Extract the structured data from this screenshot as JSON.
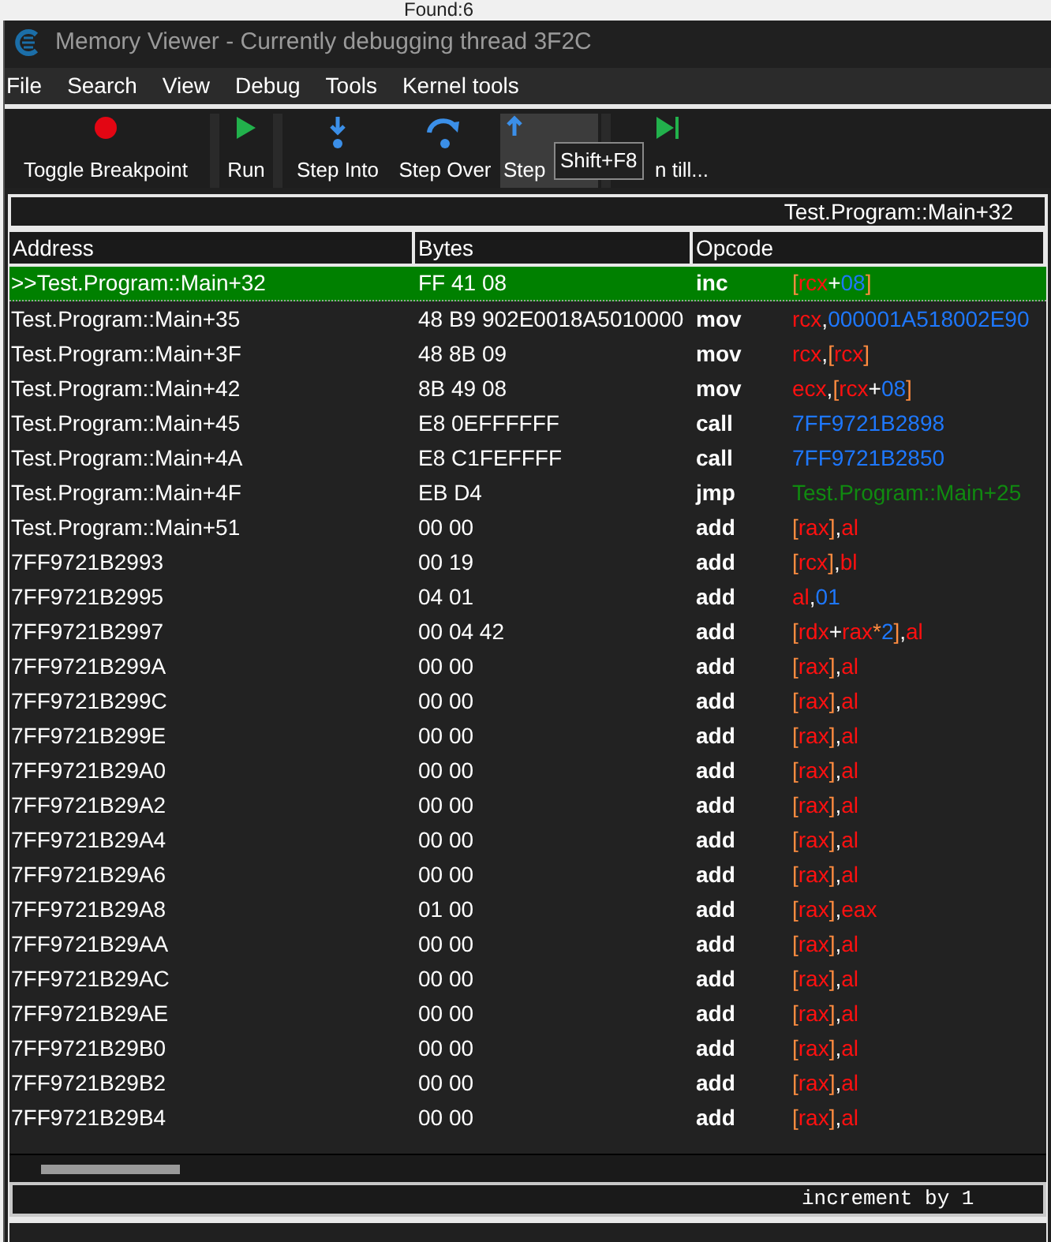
{
  "background_text": "Found:6",
  "window": {
    "title": "Memory Viewer - Currently debugging thread 3F2C"
  },
  "menu": [
    "File",
    "Search",
    "View",
    "Debug",
    "Tools",
    "Kernel tools"
  ],
  "toolbar": [
    {
      "label": "Toggle Breakpoint",
      "kind": "breakpoint",
      "hovered": false
    },
    {
      "label": "Run",
      "kind": "run",
      "hovered": false
    },
    {
      "label": "Step Into",
      "kind": "step_into",
      "hovered": false
    },
    {
      "label": "Step Over",
      "kind": "step_over",
      "hovered": false
    },
    {
      "label": "Step",
      "kind": "step_out",
      "hovered": true
    },
    {
      "label": "n till...",
      "kind": "run_till",
      "hovered": false
    }
  ],
  "tooltip": "Shift+F8",
  "address_bar": "Test.Program::Main+32",
  "table": {
    "columns": [
      "Address",
      "Bytes",
      "Opcode"
    ],
    "rows": [
      {
        "address": ">>Test.Program::Main+32",
        "bytes": "FF 41 08",
        "opcode": "inc",
        "selected": true,
        "operands": [
          {
            "text": "[",
            "kind": "bracket"
          },
          {
            "text": "rcx",
            "kind": "register"
          },
          {
            "text": "+",
            "kind": "separator"
          },
          {
            "text": "08",
            "kind": "number"
          },
          {
            "text": "]",
            "kind": "bracket"
          }
        ]
      },
      {
        "address": "Test.Program::Main+35",
        "bytes": "48 B9 902E0018A5010000",
        "opcode": "mov",
        "selected": false,
        "operands": [
          {
            "text": "rcx",
            "kind": "register"
          },
          {
            "text": ",",
            "kind": "separator"
          },
          {
            "text": "000001A518002E90",
            "kind": "number"
          }
        ]
      },
      {
        "address": "Test.Program::Main+3F",
        "bytes": "48 8B 09",
        "opcode": "mov",
        "selected": false,
        "operands": [
          {
            "text": "rcx",
            "kind": "register"
          },
          {
            "text": ",",
            "kind": "separator"
          },
          {
            "text": "[",
            "kind": "bracket"
          },
          {
            "text": "rcx",
            "kind": "register"
          },
          {
            "text": "]",
            "kind": "bracket"
          }
        ]
      },
      {
        "address": "Test.Program::Main+42",
        "bytes": "8B 49 08",
        "opcode": "mov",
        "selected": false,
        "operands": [
          {
            "text": "ecx",
            "kind": "register"
          },
          {
            "text": ",",
            "kind": "separator"
          },
          {
            "text": "[",
            "kind": "bracket"
          },
          {
            "text": "rcx",
            "kind": "register"
          },
          {
            "text": "+",
            "kind": "separator"
          },
          {
            "text": "08",
            "kind": "number"
          },
          {
            "text": "]",
            "kind": "bracket"
          }
        ]
      },
      {
        "address": "Test.Program::Main+45",
        "bytes": "E8 0EFFFFFF",
        "opcode": "call",
        "selected": false,
        "operands": [
          {
            "text": "7FF9721B2898",
            "kind": "number"
          }
        ]
      },
      {
        "address": "Test.Program::Main+4A",
        "bytes": "E8 C1FEFFFF",
        "opcode": "call",
        "selected": false,
        "operands": [
          {
            "text": "7FF9721B2850",
            "kind": "number"
          }
        ]
      },
      {
        "address": "Test.Program::Main+4F",
        "bytes": "EB D4",
        "opcode": "jmp",
        "selected": false,
        "operands": [
          {
            "text": "Test.Program::Main+25",
            "kind": "symbol"
          }
        ]
      },
      {
        "address": "Test.Program::Main+51",
        "bytes": "00 00",
        "opcode": "add",
        "selected": false,
        "operands": [
          {
            "text": "[",
            "kind": "bracket"
          },
          {
            "text": "rax",
            "kind": "register"
          },
          {
            "text": "]",
            "kind": "bracket"
          },
          {
            "text": ",",
            "kind": "separator"
          },
          {
            "text": "al",
            "kind": "register"
          }
        ]
      },
      {
        "address": "7FF9721B2993",
        "bytes": "00 19",
        "opcode": "add",
        "selected": false,
        "operands": [
          {
            "text": "[",
            "kind": "bracket"
          },
          {
            "text": "rcx",
            "kind": "register"
          },
          {
            "text": "]",
            "kind": "bracket"
          },
          {
            "text": ",",
            "kind": "separator"
          },
          {
            "text": "bl",
            "kind": "register"
          }
        ]
      },
      {
        "address": "7FF9721B2995",
        "bytes": "04 01",
        "opcode": "add",
        "selected": false,
        "operands": [
          {
            "text": "al",
            "kind": "register"
          },
          {
            "text": ",",
            "kind": "separator"
          },
          {
            "text": "01",
            "kind": "number"
          }
        ]
      },
      {
        "address": "7FF9721B2997",
        "bytes": "00 04 42",
        "opcode": "add",
        "selected": false,
        "operands": [
          {
            "text": "[",
            "kind": "bracket"
          },
          {
            "text": "rdx",
            "kind": "register"
          },
          {
            "text": "+",
            "kind": "separator"
          },
          {
            "text": "rax",
            "kind": "register"
          },
          {
            "text": "*",
            "kind": "bracket"
          },
          {
            "text": "2",
            "kind": "number"
          },
          {
            "text": "]",
            "kind": "bracket"
          },
          {
            "text": ",",
            "kind": "separator"
          },
          {
            "text": "al",
            "kind": "register"
          }
        ]
      },
      {
        "address": "7FF9721B299A",
        "bytes": "00 00",
        "opcode": "add",
        "selected": false,
        "operands": [
          {
            "text": "[",
            "kind": "bracket"
          },
          {
            "text": "rax",
            "kind": "register"
          },
          {
            "text": "]",
            "kind": "bracket"
          },
          {
            "text": ",",
            "kind": "separator"
          },
          {
            "text": "al",
            "kind": "register"
          }
        ]
      },
      {
        "address": "7FF9721B299C",
        "bytes": "00 00",
        "opcode": "add",
        "selected": false,
        "operands": [
          {
            "text": "[",
            "kind": "bracket"
          },
          {
            "text": "rax",
            "kind": "register"
          },
          {
            "text": "]",
            "kind": "bracket"
          },
          {
            "text": ",",
            "kind": "separator"
          },
          {
            "text": "al",
            "kind": "register"
          }
        ]
      },
      {
        "address": "7FF9721B299E",
        "bytes": "00 00",
        "opcode": "add",
        "selected": false,
        "operands": [
          {
            "text": "[",
            "kind": "bracket"
          },
          {
            "text": "rax",
            "kind": "register"
          },
          {
            "text": "]",
            "kind": "bracket"
          },
          {
            "text": ",",
            "kind": "separator"
          },
          {
            "text": "al",
            "kind": "register"
          }
        ]
      },
      {
        "address": "7FF9721B29A0",
        "bytes": "00 00",
        "opcode": "add",
        "selected": false,
        "operands": [
          {
            "text": "[",
            "kind": "bracket"
          },
          {
            "text": "rax",
            "kind": "register"
          },
          {
            "text": "]",
            "kind": "bracket"
          },
          {
            "text": ",",
            "kind": "separator"
          },
          {
            "text": "al",
            "kind": "register"
          }
        ]
      },
      {
        "address": "7FF9721B29A2",
        "bytes": "00 00",
        "opcode": "add",
        "selected": false,
        "operands": [
          {
            "text": "[",
            "kind": "bracket"
          },
          {
            "text": "rax",
            "kind": "register"
          },
          {
            "text": "]",
            "kind": "bracket"
          },
          {
            "text": ",",
            "kind": "separator"
          },
          {
            "text": "al",
            "kind": "register"
          }
        ]
      },
      {
        "address": "7FF9721B29A4",
        "bytes": "00 00",
        "opcode": "add",
        "selected": false,
        "operands": [
          {
            "text": "[",
            "kind": "bracket"
          },
          {
            "text": "rax",
            "kind": "register"
          },
          {
            "text": "]",
            "kind": "bracket"
          },
          {
            "text": ",",
            "kind": "separator"
          },
          {
            "text": "al",
            "kind": "register"
          }
        ]
      },
      {
        "address": "7FF9721B29A6",
        "bytes": "00 00",
        "opcode": "add",
        "selected": false,
        "operands": [
          {
            "text": "[",
            "kind": "bracket"
          },
          {
            "text": "rax",
            "kind": "register"
          },
          {
            "text": "]",
            "kind": "bracket"
          },
          {
            "text": ",",
            "kind": "separator"
          },
          {
            "text": "al",
            "kind": "register"
          }
        ]
      },
      {
        "address": "7FF9721B29A8",
        "bytes": "01 00",
        "opcode": "add",
        "selected": false,
        "operands": [
          {
            "text": "[",
            "kind": "bracket"
          },
          {
            "text": "rax",
            "kind": "register"
          },
          {
            "text": "]",
            "kind": "bracket"
          },
          {
            "text": ",",
            "kind": "separator"
          },
          {
            "text": "eax",
            "kind": "register"
          }
        ]
      },
      {
        "address": "7FF9721B29AA",
        "bytes": "00 00",
        "opcode": "add",
        "selected": false,
        "operands": [
          {
            "text": "[",
            "kind": "bracket"
          },
          {
            "text": "rax",
            "kind": "register"
          },
          {
            "text": "]",
            "kind": "bracket"
          },
          {
            "text": ",",
            "kind": "separator"
          },
          {
            "text": "al",
            "kind": "register"
          }
        ]
      },
      {
        "address": "7FF9721B29AC",
        "bytes": "00 00",
        "opcode": "add",
        "selected": false,
        "operands": [
          {
            "text": "[",
            "kind": "bracket"
          },
          {
            "text": "rax",
            "kind": "register"
          },
          {
            "text": "]",
            "kind": "bracket"
          },
          {
            "text": ",",
            "kind": "separator"
          },
          {
            "text": "al",
            "kind": "register"
          }
        ]
      },
      {
        "address": "7FF9721B29AE",
        "bytes": "00 00",
        "opcode": "add",
        "selected": false,
        "operands": [
          {
            "text": "[",
            "kind": "bracket"
          },
          {
            "text": "rax",
            "kind": "register"
          },
          {
            "text": "]",
            "kind": "bracket"
          },
          {
            "text": ",",
            "kind": "separator"
          },
          {
            "text": "al",
            "kind": "register"
          }
        ]
      },
      {
        "address": "7FF9721B29B0",
        "bytes": "00 00",
        "opcode": "add",
        "selected": false,
        "operands": [
          {
            "text": "[",
            "kind": "bracket"
          },
          {
            "text": "rax",
            "kind": "register"
          },
          {
            "text": "]",
            "kind": "bracket"
          },
          {
            "text": ",",
            "kind": "separator"
          },
          {
            "text": "al",
            "kind": "register"
          }
        ]
      },
      {
        "address": "7FF9721B29B2",
        "bytes": "00 00",
        "opcode": "add",
        "selected": false,
        "operands": [
          {
            "text": "[",
            "kind": "bracket"
          },
          {
            "text": "rax",
            "kind": "register"
          },
          {
            "text": "]",
            "kind": "bracket"
          },
          {
            "text": ",",
            "kind": "separator"
          },
          {
            "text": "al",
            "kind": "register"
          }
        ]
      },
      {
        "address": "7FF9721B29B4",
        "bytes": "00 00",
        "opcode": "add",
        "selected": false,
        "operands": [
          {
            "text": "[",
            "kind": "bracket"
          },
          {
            "text": "rax",
            "kind": "register"
          },
          {
            "text": "]",
            "kind": "bracket"
          },
          {
            "text": ",",
            "kind": "separator"
          },
          {
            "text": "al",
            "kind": "register"
          }
        ]
      }
    ]
  },
  "status": "increment by 1"
}
